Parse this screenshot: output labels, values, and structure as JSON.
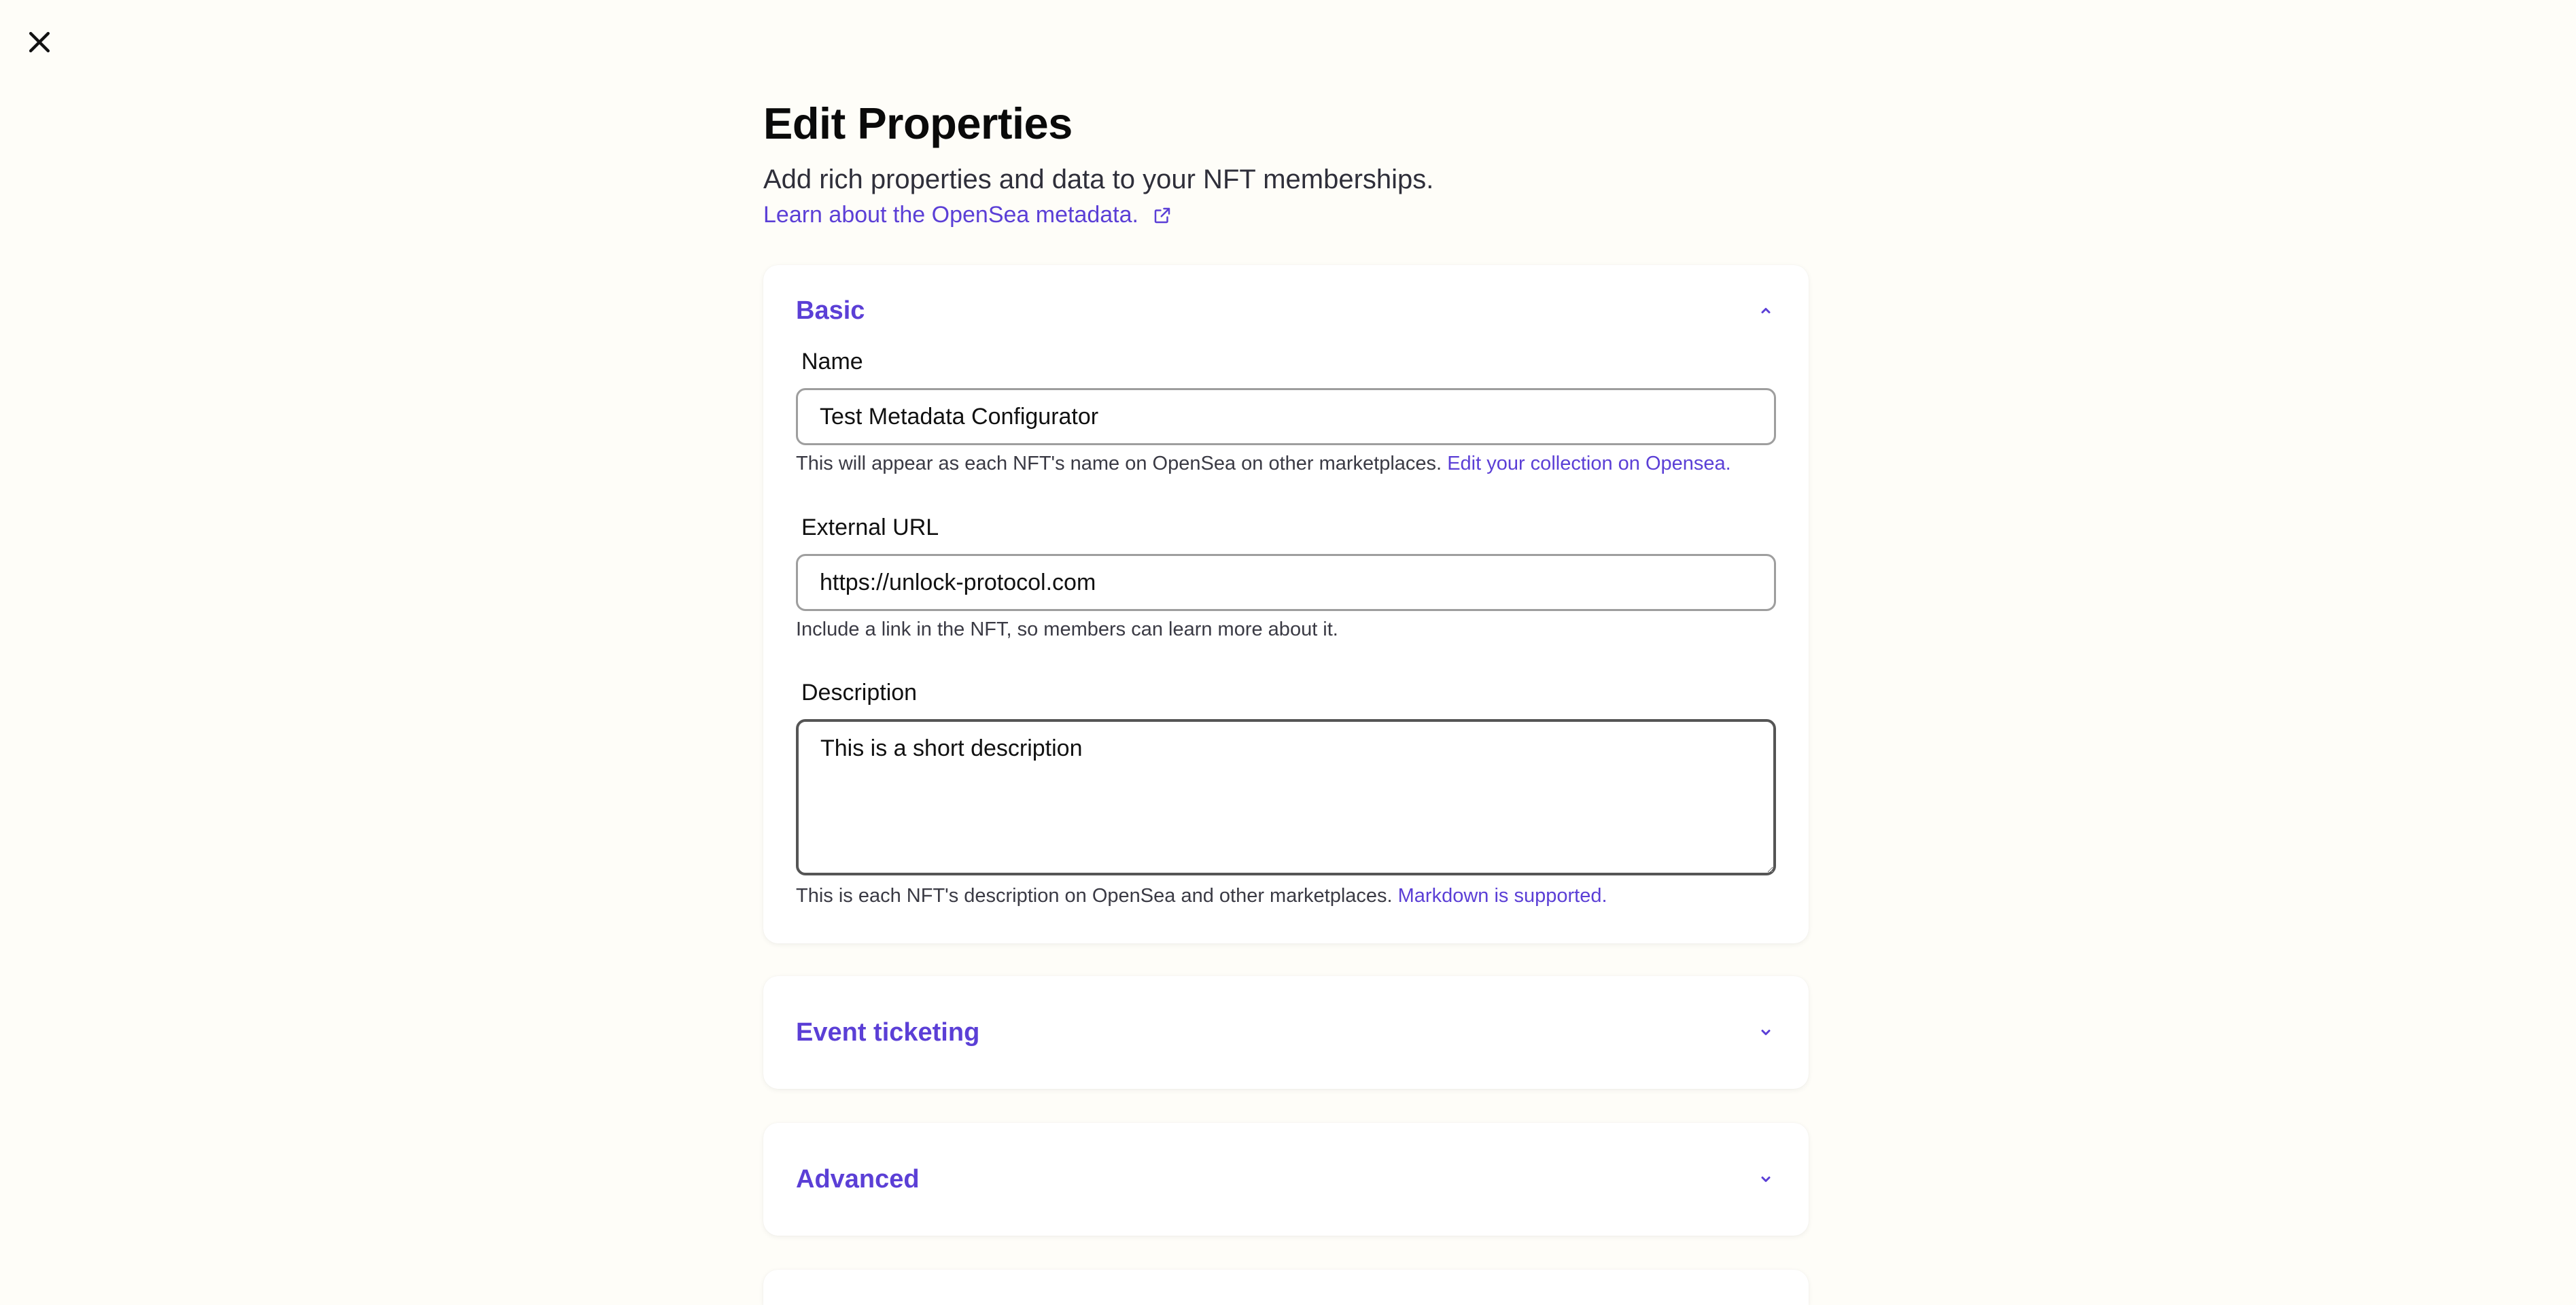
{
  "page": {
    "title": "Edit Properties",
    "subtitle": "Add rich properties and data to your NFT memberships.",
    "learn_link": "Learn about the OpenSea metadata."
  },
  "sections": {
    "basic": {
      "title": "Basic",
      "expanded": true,
      "name": {
        "label": "Name",
        "value": "Test Metadata Configurator",
        "help": "This will appear as each NFT's name on OpenSea on other marketplaces.",
        "help_link": "Edit your collection on Opensea."
      },
      "external_url": {
        "label": "External URL",
        "value": "https://unlock-protocol.com",
        "help": "Include a link in the NFT, so members can learn more about it."
      },
      "description": {
        "label": "Description",
        "value": "This is a short description",
        "help": "This is each NFT's description on OpenSea and other marketplaces.",
        "help_link": "Markdown is supported."
      }
    },
    "event_ticketing": {
      "title": "Event ticketing",
      "expanded": false
    },
    "advanced": {
      "title": "Advanced",
      "expanded": false
    }
  },
  "icons": {
    "close": "close-icon",
    "external_link": "external-link-icon",
    "collapse": "chevron-up-icon",
    "expand": "chevron-down-icon"
  },
  "colors": {
    "accent": "#5b3fd6",
    "background": "#fefdf8",
    "card": "#ffffff"
  }
}
